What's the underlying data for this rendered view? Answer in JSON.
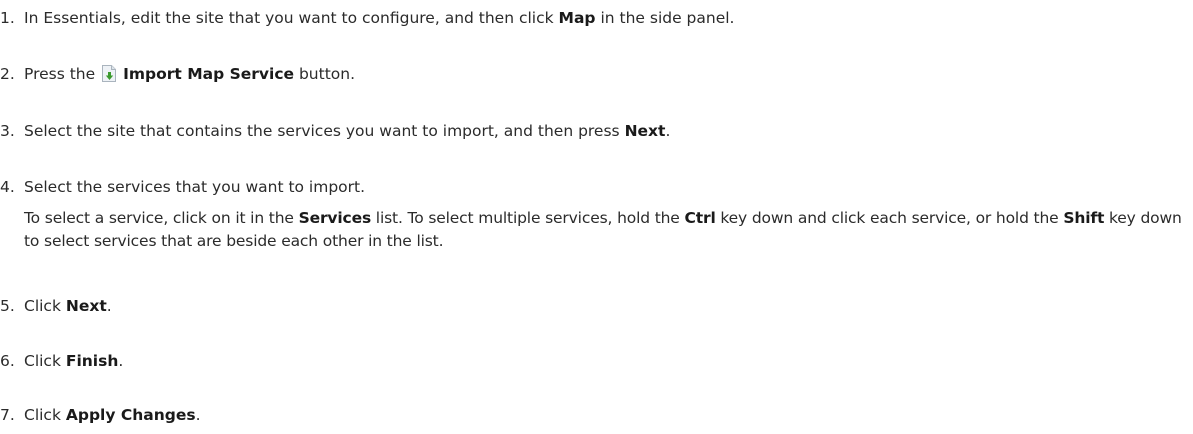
{
  "steps": [
    {
      "number": "1.",
      "parts": [
        "In Essentials, edit the site that you want to configure, and then click ",
        "Map",
        " in the side panel."
      ]
    },
    {
      "number": "2.",
      "parts": [
        "Press the ",
        "Import Map Service",
        " button."
      ],
      "icon": "import-map-service-icon"
    },
    {
      "number": "3.",
      "parts": [
        "Select the site that contains the services you want to import, and then press ",
        "Next",
        "."
      ]
    },
    {
      "number": "4.",
      "parts": [
        "Select the services that you want to import."
      ],
      "detail": [
        "To select a service, click on it in the ",
        "Services",
        " list. To select multiple services, hold the ",
        "Ctrl",
        " key down and click each service, or hold the ",
        "Shift",
        " key down to select services that are beside each other in the list."
      ]
    },
    {
      "number": "5.",
      "parts": [
        "Click ",
        "Next",
        "."
      ]
    },
    {
      "number": "6.",
      "parts": [
        "Click ",
        "Finish",
        "."
      ]
    },
    {
      "number": "7.",
      "parts": [
        "Click ",
        "Apply Changes",
        "."
      ]
    }
  ],
  "colors": {
    "text": "#2b2b2b",
    "icon_page": "#e8eef4",
    "icon_arrow": "#3c9a2e"
  }
}
